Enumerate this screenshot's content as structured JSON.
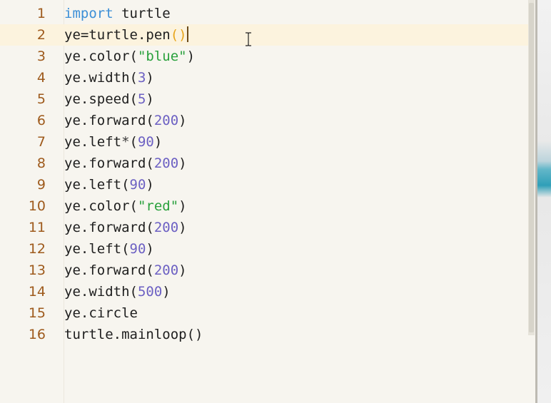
{
  "editor": {
    "current_line": 2,
    "lines": [
      {
        "number": "1",
        "tokens": [
          {
            "t": "kw",
            "v": "import"
          },
          {
            "t": "plain",
            "v": " turtle"
          }
        ]
      },
      {
        "number": "2",
        "tokens": [
          {
            "t": "plain",
            "v": "ye=turtle.pen"
          },
          {
            "t": "paren",
            "v": "()"
          }
        ]
      },
      {
        "number": "3",
        "tokens": [
          {
            "t": "plain",
            "v": "ye.color("
          },
          {
            "t": "str",
            "v": "\"blue\""
          },
          {
            "t": "plain",
            "v": ")"
          }
        ]
      },
      {
        "number": "4",
        "tokens": [
          {
            "t": "plain",
            "v": "ye.width("
          },
          {
            "t": "num",
            "v": "3"
          },
          {
            "t": "plain",
            "v": ")"
          }
        ]
      },
      {
        "number": "5",
        "tokens": [
          {
            "t": "plain",
            "v": "ye.speed("
          },
          {
            "t": "num",
            "v": "5"
          },
          {
            "t": "plain",
            "v": ")"
          }
        ]
      },
      {
        "number": "6",
        "tokens": [
          {
            "t": "plain",
            "v": "ye.forward("
          },
          {
            "t": "num",
            "v": "200"
          },
          {
            "t": "plain",
            "v": ")"
          }
        ]
      },
      {
        "number": "7",
        "tokens": [
          {
            "t": "plain",
            "v": "ye.left"
          },
          {
            "t": "op",
            "v": "*"
          },
          {
            "t": "plain",
            "v": "("
          },
          {
            "t": "num",
            "v": "90"
          },
          {
            "t": "plain",
            "v": ")"
          }
        ]
      },
      {
        "number": "8",
        "tokens": [
          {
            "t": "plain",
            "v": "ye.forward("
          },
          {
            "t": "num",
            "v": "200"
          },
          {
            "t": "plain",
            "v": ")"
          }
        ]
      },
      {
        "number": "9",
        "tokens": [
          {
            "t": "plain",
            "v": "ye.left("
          },
          {
            "t": "num",
            "v": "90"
          },
          {
            "t": "plain",
            "v": ")"
          }
        ]
      },
      {
        "number": "10",
        "tokens": [
          {
            "t": "plain",
            "v": "ye.color("
          },
          {
            "t": "str",
            "v": "\"red\""
          },
          {
            "t": "plain",
            "v": ")"
          }
        ]
      },
      {
        "number": "11",
        "tokens": [
          {
            "t": "plain",
            "v": "ye.forward("
          },
          {
            "t": "num",
            "v": "200"
          },
          {
            "t": "plain",
            "v": ")"
          }
        ]
      },
      {
        "number": "12",
        "tokens": [
          {
            "t": "plain",
            "v": "ye.left("
          },
          {
            "t": "num",
            "v": "90"
          },
          {
            "t": "plain",
            "v": ")"
          }
        ]
      },
      {
        "number": "13",
        "tokens": [
          {
            "t": "plain",
            "v": "ye.forward("
          },
          {
            "t": "num",
            "v": "200"
          },
          {
            "t": "plain",
            "v": ")"
          }
        ]
      },
      {
        "number": "14",
        "tokens": [
          {
            "t": "plain",
            "v": "ye.width("
          },
          {
            "t": "num",
            "v": "500"
          },
          {
            "t": "plain",
            "v": ")"
          }
        ]
      },
      {
        "number": "15",
        "tokens": [
          {
            "t": "plain",
            "v": "ye.circle"
          }
        ]
      },
      {
        "number": "16",
        "tokens": [
          {
            "t": "plain",
            "v": "turtle.mainloop()"
          }
        ]
      }
    ]
  },
  "colors": {
    "background": "#f7f5ef",
    "current_line": "#fcf3de",
    "line_number": "#9e5a1c",
    "keyword": "#3c8fd7",
    "number": "#6c60c3",
    "string": "#2aa13d",
    "bracket_match": "#e8a51a"
  },
  "icons": {
    "mouse_cursor": "i-beam-cursor-icon"
  }
}
